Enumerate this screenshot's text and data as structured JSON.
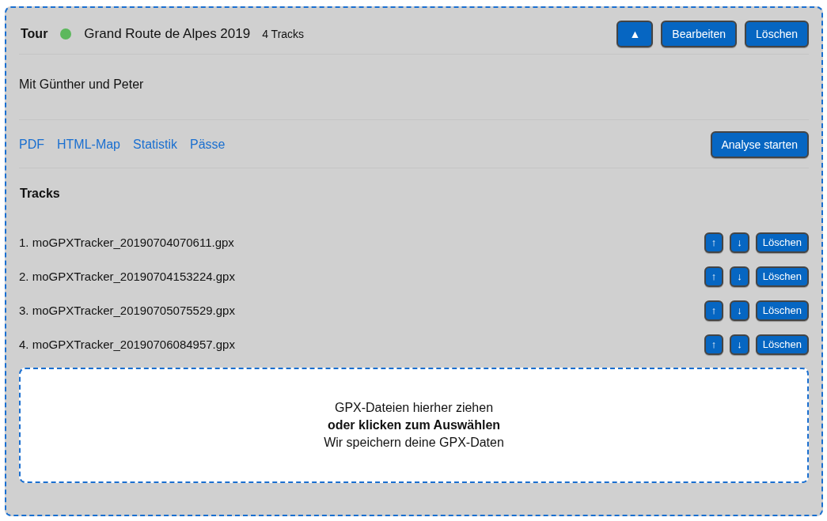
{
  "tour": {
    "label": "Tour",
    "color": "#5cb85c",
    "name": "Grand Route de Alpes 2019",
    "track_count": "4 Tracks",
    "buttons": [
      {
        "label": "▲",
        "kind": "icon"
      },
      {
        "label": "Bearbeiten",
        "kind": "text"
      },
      {
        "label": "Löschen",
        "kind": "text"
      }
    ]
  },
  "description": "Mit Günther und Peter",
  "links": [
    "PDF",
    "HTML-Map",
    "Statistik",
    "Pässe"
  ],
  "analyse_button": "Analyse starten",
  "tracks_heading": "Tracks",
  "tracks": [
    {
      "name": "1. moGPXTracker_20190704070611.gpx",
      "up": "↑",
      "down": "↓",
      "delete": "Löschen"
    },
    {
      "name": "2. moGPXTracker_20190704153224.gpx",
      "up": "↑",
      "down": "↓",
      "delete": "Löschen"
    },
    {
      "name": "3. moGPXTracker_20190705075529.gpx",
      "up": "↑",
      "down": "↓",
      "delete": "Löschen"
    },
    {
      "name": "4. moGPXTracker_20190706084957.gpx",
      "up": "↑",
      "down": "↓",
      "delete": "Löschen"
    }
  ],
  "dropzone": {
    "line_1": "GPX-Dateien hierher ziehen",
    "line_2": "oder klicken zum Auswählen",
    "line_3": "Wir speichern deine GPX-Daten"
  }
}
